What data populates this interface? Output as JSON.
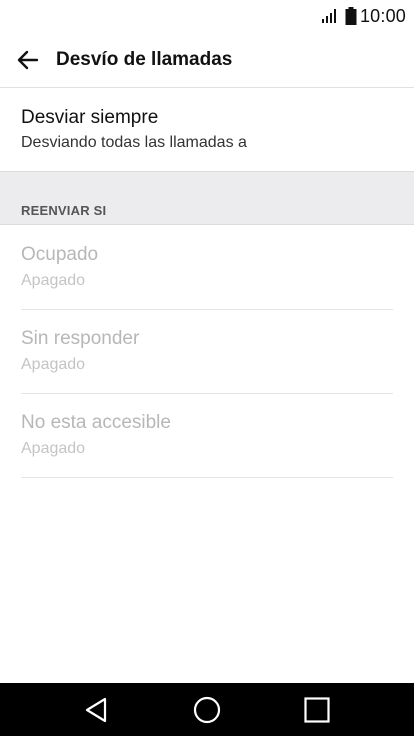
{
  "status_bar": {
    "time": "10:00",
    "icons": [
      "signal-icon",
      "battery-icon"
    ]
  },
  "app_bar": {
    "back_icon": "arrow-left-icon",
    "title": "Desvío de llamadas"
  },
  "primary_item": {
    "title": "Desviar siempre",
    "subtitle": "Desviando todas las llamadas a"
  },
  "section": {
    "header": "REENVIAR SI"
  },
  "items": [
    {
      "title": "Ocupado",
      "subtitle": "Apagado"
    },
    {
      "title": "Sin responder",
      "subtitle": "Apagado"
    },
    {
      "title": "No esta accesible",
      "subtitle": "Apagado"
    }
  ],
  "nav_bar": {
    "icons": [
      "back-triangle-icon",
      "home-circle-icon",
      "recents-square-icon"
    ]
  },
  "colors": {
    "background": "#ffffff",
    "section_bg": "#ececef",
    "disabled_text": "#b7b7b7",
    "nav_bg": "#000000"
  }
}
